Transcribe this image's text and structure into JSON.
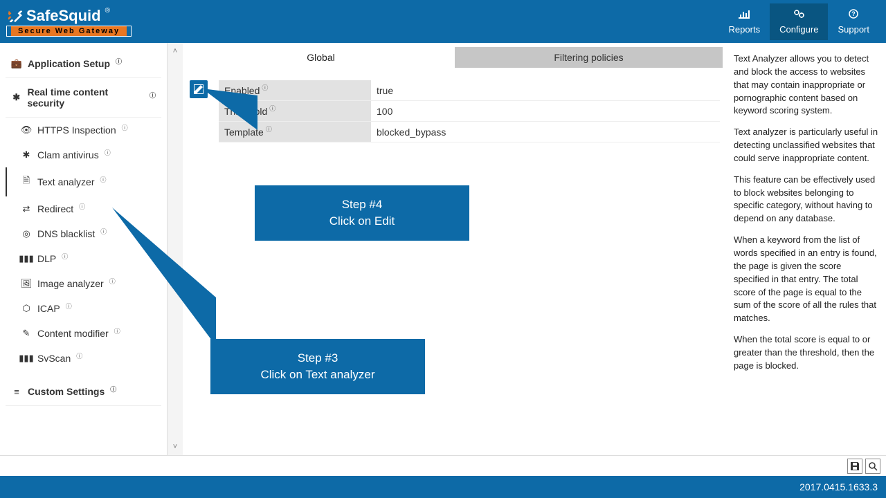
{
  "brand": {
    "name": "SafeSquid",
    "reg": "®",
    "tagline": "Secure Web Gateway"
  },
  "header": {
    "reports": "Reports",
    "configure": "Configure",
    "support": "Support"
  },
  "sidebar": {
    "app_setup": "Application Setup",
    "rtcs": "Real time content security",
    "items": [
      {
        "label": "HTTPS Inspection",
        "icon": "eye"
      },
      {
        "label": "Clam antivirus",
        "icon": "puzzle"
      },
      {
        "label": "Text analyzer",
        "icon": "file"
      },
      {
        "label": "Redirect",
        "icon": "shuffle"
      },
      {
        "label": "DNS blacklist",
        "icon": "dns"
      },
      {
        "label": "DLP",
        "icon": "barcode"
      },
      {
        "label": "Image analyzer",
        "icon": "image"
      },
      {
        "label": "ICAP",
        "icon": "gear"
      },
      {
        "label": "Content modifier",
        "icon": "pencil"
      },
      {
        "label": "SvScan",
        "icon": "barcode"
      }
    ],
    "custom": "Custom Settings"
  },
  "tabs": {
    "global": "Global",
    "filtering": "Filtering policies"
  },
  "rows": {
    "enabled": {
      "label": "Enabled",
      "value": "true"
    },
    "threshold": {
      "label": "Threshold",
      "value": "100"
    },
    "template": {
      "label": "Template",
      "value": "blocked_bypass"
    }
  },
  "callouts": {
    "step4": {
      "step": "Step #4",
      "text": "Click on Edit"
    },
    "step3": {
      "step": "Step #3",
      "text": "Click on Text analyzer"
    }
  },
  "info": {
    "p1": "Text Analyzer allows you to detect and block the access to websites that may contain inappropriate or pornographic content based on keyword scoring system.",
    "p2": "Text analyzer is particularly useful in detecting unclassified websites that could serve inappropriate content.",
    "p3": "This feature can be effectively used to block websites belonging to specific category, without having to depend on any database.",
    "p4": "When a keyword from the list of words specified in an entry is found, the page is given the score specified in that entry. The total score of the page is equal to the sum of the score of all the rules that matches.",
    "p5": "When the total score is equal to or greater than the threshold, then the page is blocked."
  },
  "footer": {
    "version": "2017.0415.1633.3"
  }
}
